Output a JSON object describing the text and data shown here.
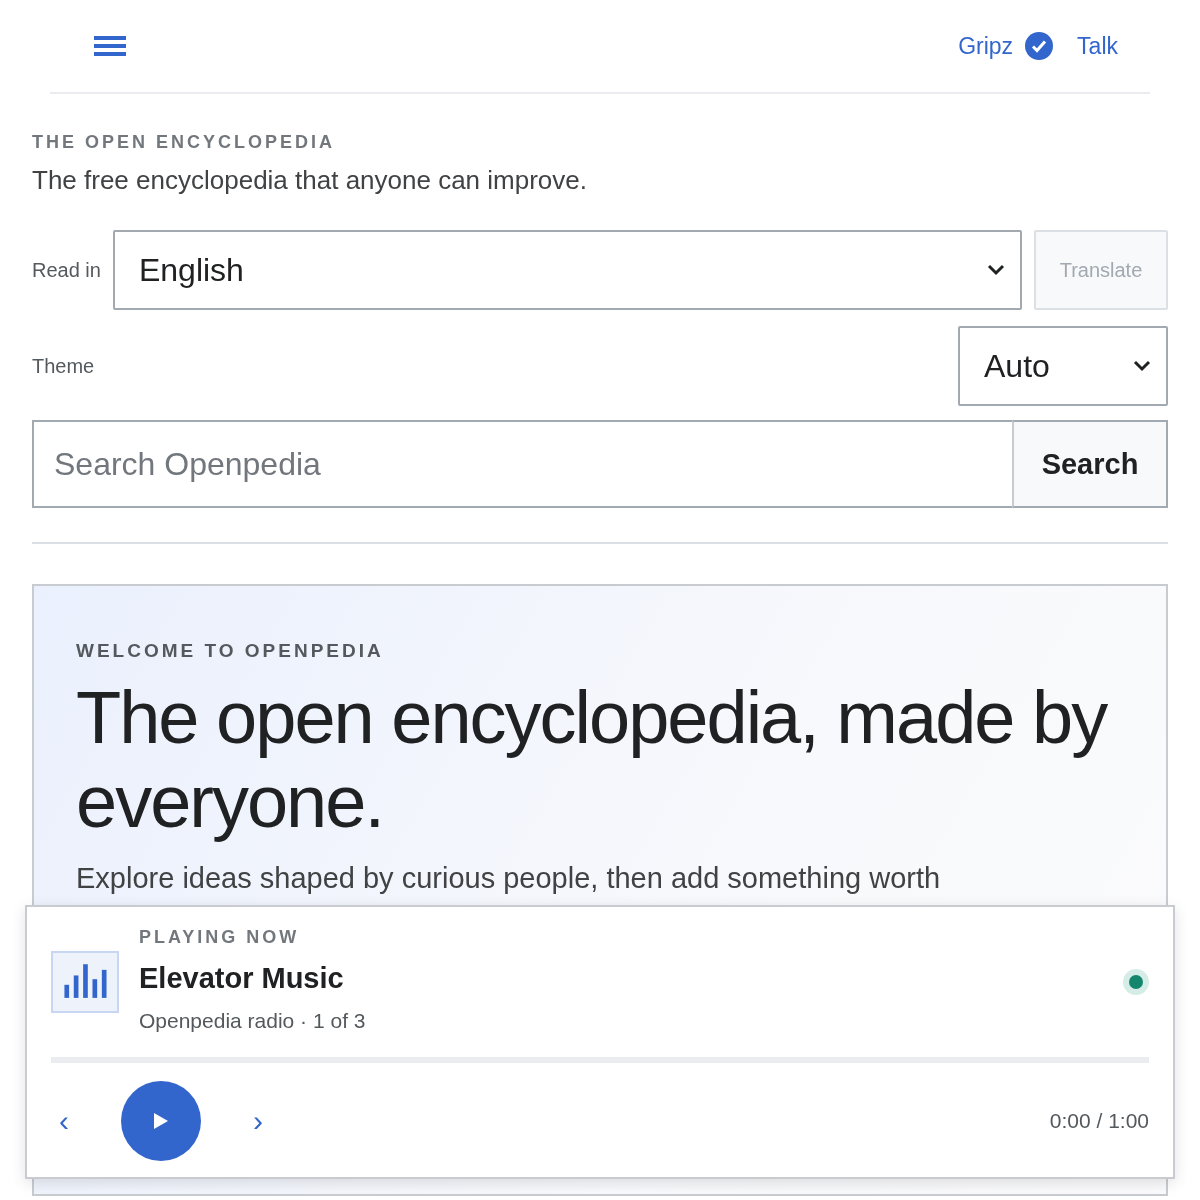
{
  "header": {
    "user": "Gripz",
    "verified": true,
    "talk": "Talk"
  },
  "intro": {
    "eyebrow": "THE OPEN ENCYCLOPEDIA",
    "tagline": "The free encyclopedia that anyone can improve."
  },
  "language": {
    "label": "Read in",
    "value": "English",
    "translate": "Translate",
    "translate_disabled": true
  },
  "theme": {
    "label": "Theme",
    "value": "Auto"
  },
  "search": {
    "placeholder": "Search Openpedia",
    "button": "Search"
  },
  "hero": {
    "eyebrow": "WELCOME TO OPENPEDIA",
    "title": "The open encyclopedia, made by everyone.",
    "text": "Explore ideas shaped by curious people, then add something worth"
  },
  "player": {
    "status": "PLAYING NOW",
    "title": "Elevator Music",
    "subtitle": "Openpedia radio · 1 of 3",
    "live": true,
    "level": 0,
    "prev": "‹",
    "next": "›",
    "time": "0:00 / 1:00"
  }
}
